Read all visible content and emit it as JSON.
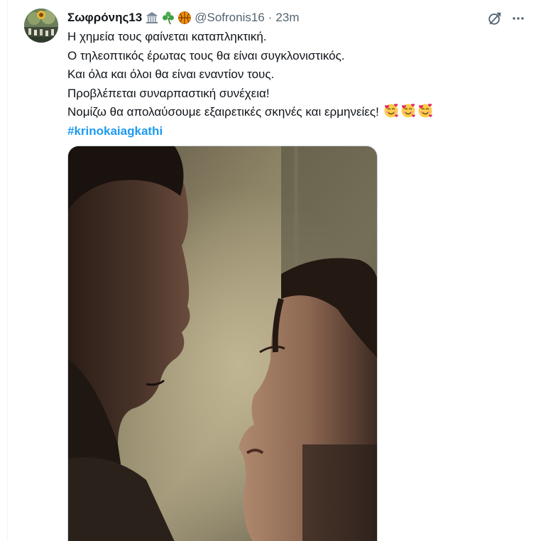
{
  "tweet": {
    "author": {
      "display_name": "Σωφρόνης13",
      "badges": [
        "classical-building-icon",
        "shamrock-icon",
        "basketball-icon"
      ],
      "handle": "@Sofronis16"
    },
    "separator": "·",
    "time": "23m",
    "text_lines": [
      "Η χημεία τους φαίνεται καταπληκτική.",
      "Ο τηλεοπτικός έρωτας τους θα είναι συγκλονιστικός.",
      "Και όλα και όλοι θα είναι εναντίον τους.",
      "Προβλέπεται συναρπαστική συνέχεια!",
      "Νομίζω θα απολαύσουμε εξαιρετικές σκηνές και ερμηνείες!"
    ],
    "trailing_emojis": [
      "smiling-face-with-hearts-icon",
      "smiling-face-with-hearts-icon",
      "smiling-face-with-hearts-icon"
    ],
    "hashtag": "#krinokaiagkathi"
  },
  "colors": {
    "text": "#0f1419",
    "secondary": "#536471",
    "link": "#1d9bf0"
  }
}
